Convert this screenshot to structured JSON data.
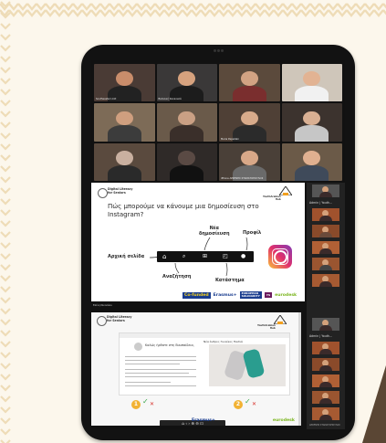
{
  "meeting": {
    "participants": [
      {
        "name": "Southeastern Ltd",
        "bg": "#4a3b35",
        "skin": "#c98d6b",
        "shirt": "#222222"
      },
      {
        "name": "Βασιλική Σακκουλά",
        "bg": "#3a3838",
        "skin": "#d6a27e",
        "shirt": "#1c1c1c"
      },
      {
        "name": "",
        "bg": "#5b4a3c",
        "skin": "#d2a383",
        "shirt": "#7a2e2e"
      },
      {
        "name": "",
        "bg": "#cfc6ba",
        "skin": "#e2b393",
        "shirt": "#f1f1f1"
      },
      {
        "name": "",
        "bg": "#7d6b57",
        "skin": "#cf9f7f",
        "shirt": "#3c3c3c"
      },
      {
        "name": "",
        "bg": "#6a5a4a",
        "skin": "#caa084",
        "shirt": "#3a2f2a"
      },
      {
        "name": "Maria Papadaki",
        "bg": "#4f4036",
        "skin": "#d8ab8b",
        "shirt": "#2b2b2b"
      },
      {
        "name": "",
        "bg": "#3c332e",
        "skin": "#d9b093",
        "shirt": "#c6c6c6"
      },
      {
        "name": "",
        "bg": "#5a4a3e",
        "skin": "#c9b0a0",
        "shirt": "#2a2a2a"
      },
      {
        "name": "",
        "bg": "#2f2a28",
        "skin": "#5a4a44",
        "shirt": "#111111"
      },
      {
        "name": "iPhone ΑΡΣΕΝΗΣ ΣΤΑΜΑΤΟΠΟΥΛΟΣ",
        "bg": "#4a4038",
        "skin": "#d8a888",
        "shirt": "#6a6a6a"
      },
      {
        "name": "",
        "bg": "#6b5a48",
        "skin": "#e0b090",
        "shirt": "#3f4a5a"
      }
    ],
    "sidebar": {
      "admin_label_1": "Admin | Youth...",
      "admin_label_2": "Admin | Youth...",
      "name_tag": "ΑΡΣΕΝΗΣ ΣΤΑΜΑΤΟΠΟΥΛΟΣ"
    },
    "presenter_tag_1": "Ελένη Νικολάου",
    "presenter_tag_2": "Ελένη Νικολάου"
  },
  "slide1": {
    "brand": "Digital Literacy\nfor Seniors",
    "partner": "YouthArabian\nHub",
    "title": "Πώς μπορούμε να κάνουμε μια δημοσίευση στο Instagram?",
    "labels": {
      "new_post": "Νέα\nδημοσίευση",
      "profile": "Προφίλ",
      "home": "Αρχική σελίδα",
      "search": "Αναζήτηση",
      "shop": "Κατάστημα"
    },
    "icons": [
      "home-icon",
      "search-icon",
      "plus-icon",
      "bag-icon",
      "avatar-icon"
    ],
    "footer": {
      "eu": "Co-funded",
      "erasmus": "Erasmus+",
      "euso": "EUROPEAN\nSOLIDARITY",
      "ys": "YS",
      "eurodesk": "eurodesk"
    }
  },
  "slide2": {
    "brand": "Digital Literacy\nfor Seniors",
    "partner": "YouthArabian\nHub",
    "wiki_title": "Καλώς ήρθατε στη Βικιπαίδεια,",
    "shop_nav": "Νέα   Άνδρες   Γυναίκες   Παιδιά",
    "badge1": "1",
    "badge2": "2",
    "check": "✓",
    "cross": "✕",
    "controls": "⌂  ‹  ›  ⊕  ⊖  ⊡",
    "footer": {
      "erasmus": "Erasmus+",
      "eurodesk": "eurodesk"
    }
  },
  "colors": {
    "accent_instagram": "#e1306c",
    "zoom_bg": "#111111",
    "page_bg": "#fcf7ec",
    "pattern": "#eedcb7"
  }
}
